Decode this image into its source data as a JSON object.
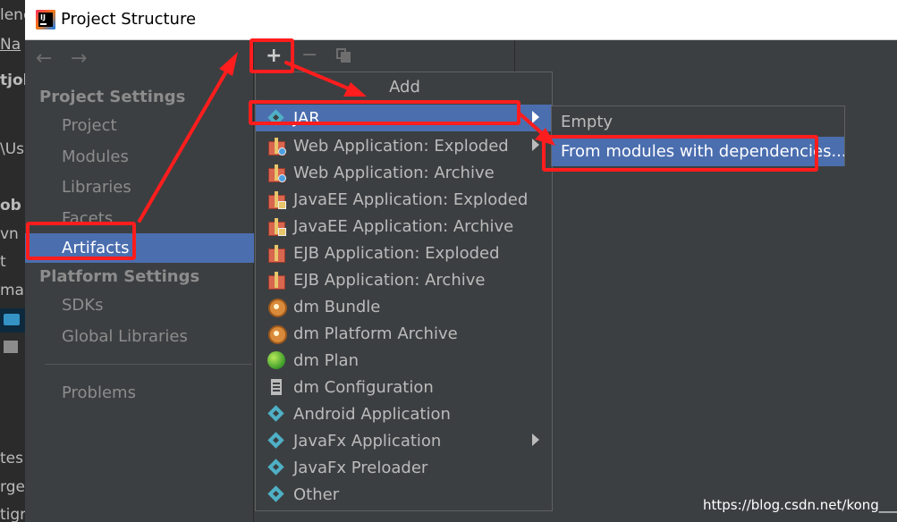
{
  "background_ide": {
    "fragments": [
      "lenc",
      "Na",
      "tjol",
      "\\Us",
      "ob",
      "vn",
      "t",
      "ma",
      "tes",
      "rget",
      "tign"
    ]
  },
  "window": {
    "title": "Project Structure",
    "icon": "intellij-idea-icon"
  },
  "sidebar": {
    "back_icon": "left-arrow-icon",
    "forward_icon": "right-arrow-icon",
    "project_settings_heading": "Project Settings",
    "project_items": [
      "Project",
      "Modules",
      "Libraries",
      "Facets",
      "Artifacts"
    ],
    "selected_item": "Artifacts",
    "platform_settings_heading": "Platform Settings",
    "platform_items": [
      "SDKs",
      "Global Libraries"
    ],
    "problems_label": "Problems"
  },
  "toolbar": {
    "add_label": "+",
    "remove_label": "−",
    "copy_icon": "copy-icon"
  },
  "add_menu": {
    "header": "Add",
    "items": [
      {
        "label": "JAR",
        "icon": "diamond-icon",
        "submenu": true,
        "selected": true
      },
      {
        "label": "Web Application: Exploded",
        "icon": "gift-web-icon",
        "submenu": true
      },
      {
        "label": "Web Application: Archive",
        "icon": "gift-web-icon"
      },
      {
        "label": "JavaEE Application: Exploded",
        "icon": "gift-javaee-icon"
      },
      {
        "label": "JavaEE Application: Archive",
        "icon": "gift-javaee-icon"
      },
      {
        "label": "EJB Application: Exploded",
        "icon": "gift-ejb-icon"
      },
      {
        "label": "EJB Application: Archive",
        "icon": "gift-ejb-icon"
      },
      {
        "label": "dm Bundle",
        "icon": "bundle-icon"
      },
      {
        "label": "dm Platform Archive",
        "icon": "bundle-archive-icon"
      },
      {
        "label": "dm Plan",
        "icon": "globe-icon"
      },
      {
        "label": "dm Configuration",
        "icon": "config-file-icon"
      },
      {
        "label": "Android Application",
        "icon": "diamond-icon"
      },
      {
        "label": "JavaFx Application",
        "icon": "diamond-icon",
        "submenu": true
      },
      {
        "label": "JavaFx Preloader",
        "icon": "diamond-icon"
      },
      {
        "label": "Other",
        "icon": "diamond-icon"
      }
    ]
  },
  "jar_submenu": {
    "items": [
      "Empty",
      "From modules with dependencies..."
    ],
    "selected_item": "From modules with dependencies..."
  },
  "annotation_color": "#ff1d1d",
  "accent_color": "#4b6eaf",
  "watermark": "https://blog.csdn.net/kong___"
}
